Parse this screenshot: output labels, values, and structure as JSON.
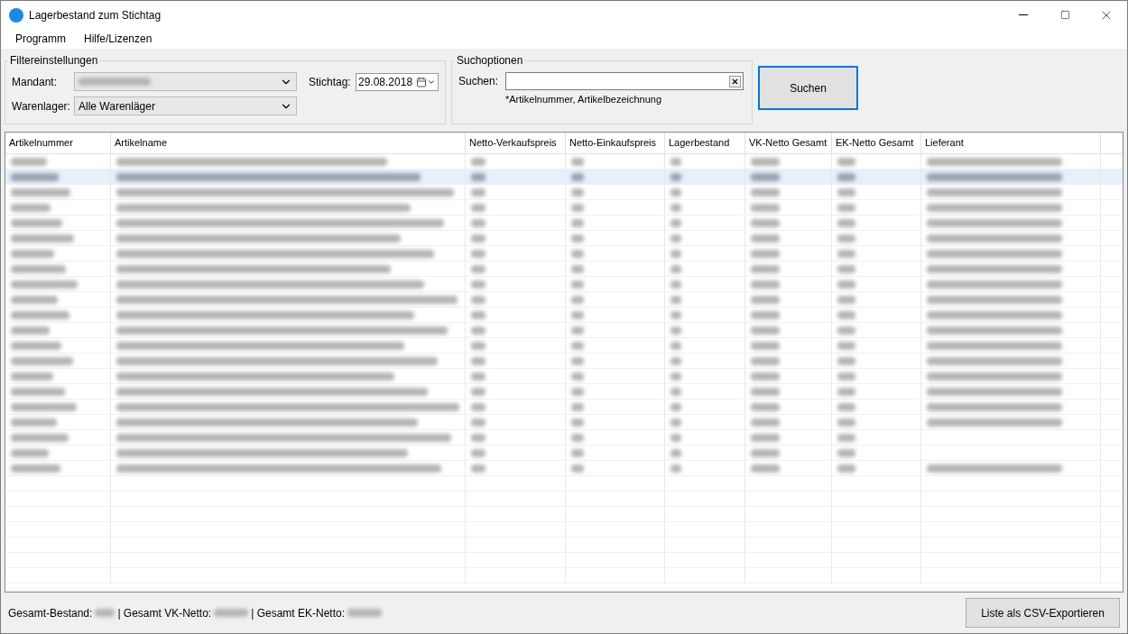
{
  "window": {
    "title": "Lagerbestand zum Stichtag"
  },
  "menu": [
    "Programm",
    "Hilfe/Lizenzen"
  ],
  "filter": {
    "legend": "Filtereinstellungen",
    "mandant_label": "Mandant:",
    "warenlager_label": "Warenlager:",
    "warenlager_value": "Alle Warenläger",
    "stichtag_label": "Stichtag:",
    "stichtag_value": "29.08.2018"
  },
  "search": {
    "legend": "Suchoptionen",
    "label": "Suchen:",
    "hint": "*Artikelnummer, Artikelbezeichnung",
    "button": "Suchen"
  },
  "table": {
    "columns": [
      "Artikelnummer",
      "Artikelname",
      "Netto-Verkaufspreis",
      "Netto-Einkaufspreis",
      "Lagerbestand",
      "VK-Netto Gesamt",
      "EK-Netto Gesamt",
      "Lieferant"
    ],
    "rows": [
      {
        "selected": false,
        "has_supplier": true
      },
      {
        "selected": true,
        "has_supplier": true
      },
      {
        "selected": false,
        "has_supplier": true
      },
      {
        "selected": false,
        "has_supplier": true
      },
      {
        "selected": false,
        "has_supplier": true
      },
      {
        "selected": false,
        "has_supplier": true
      },
      {
        "selected": false,
        "has_supplier": true
      },
      {
        "selected": false,
        "has_supplier": true
      },
      {
        "selected": false,
        "has_supplier": true
      },
      {
        "selected": false,
        "has_supplier": true
      },
      {
        "selected": false,
        "has_supplier": true
      },
      {
        "selected": false,
        "has_supplier": true
      },
      {
        "selected": false,
        "has_supplier": true
      },
      {
        "selected": false,
        "has_supplier": true
      },
      {
        "selected": false,
        "has_supplier": true
      },
      {
        "selected": false,
        "has_supplier": true
      },
      {
        "selected": false,
        "has_supplier": true
      },
      {
        "selected": false,
        "has_supplier": true
      },
      {
        "selected": false,
        "has_supplier": false
      },
      {
        "selected": false,
        "has_supplier": false
      },
      {
        "selected": false,
        "has_supplier": true
      }
    ]
  },
  "footer": {
    "labels": [
      "Gesamt-Bestand:",
      "| Gesamt VK-Netto:",
      "| Gesamt EK-Netto:"
    ],
    "export_button": "Liste als CSV-Exportieren"
  }
}
